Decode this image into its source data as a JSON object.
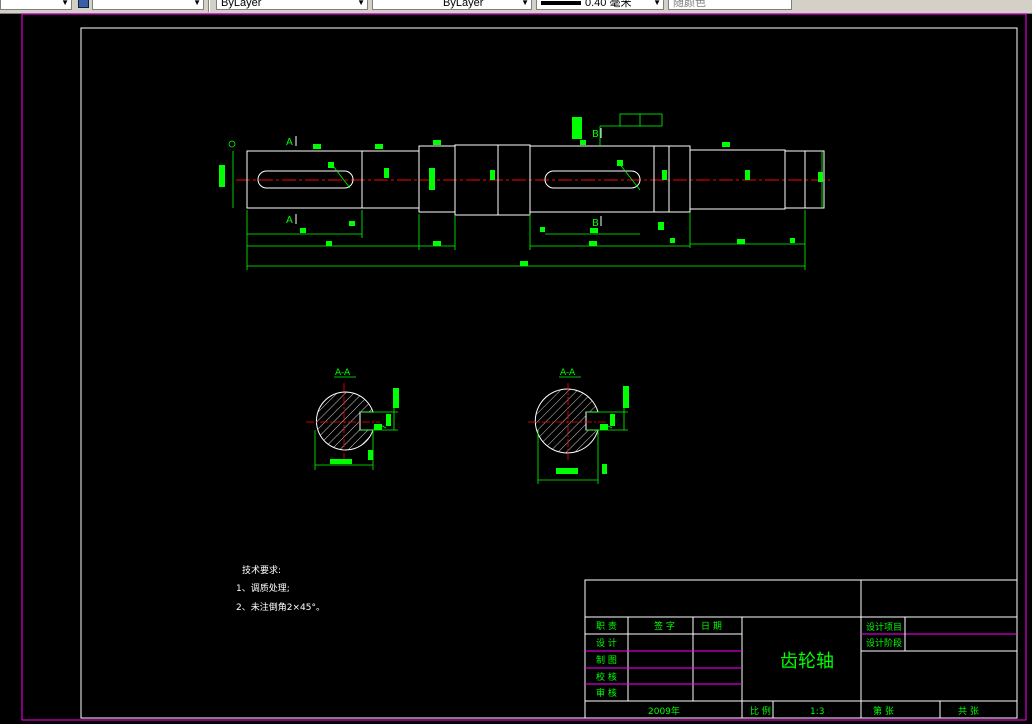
{
  "toolbar": {
    "layer_value": "ByLayer",
    "linetype_value": "ByLayer",
    "lineweight_value": "0.40 毫米",
    "plotstyle_value": "随颜色"
  },
  "notes": {
    "heading": "技术要求:",
    "line1": "1、调质处理;",
    "line2": "2、未注倒角2×45°。"
  },
  "section_labels": {
    "aa": "A-A",
    "bb": "A-A"
  },
  "view_labels": {
    "a_top": "A",
    "a_bottom": "A",
    "b_top": "B",
    "b_bottom": "B"
  },
  "title_block": {
    "part_name": "齿轮轴",
    "col_role": "职 责",
    "col_sign": "签 字",
    "col_date": "日 期",
    "row_design": "设 计",
    "row_draw": "制 图",
    "row_check": "校 核",
    "row_review": "审 核",
    "design_project": "设计项目",
    "design_stage": "设计阶段",
    "year": "2009年",
    "scale_label": "比 例",
    "scale_value": "1:3",
    "sheet_no": "第 张",
    "sheet_total": "共 张"
  },
  "colors": {
    "background": "#000000",
    "frame": "#ff00ff",
    "geometry": "#ffffff",
    "dimension": "#00ff00",
    "centerline": "#ff0000",
    "title_text": "#00ff00"
  }
}
